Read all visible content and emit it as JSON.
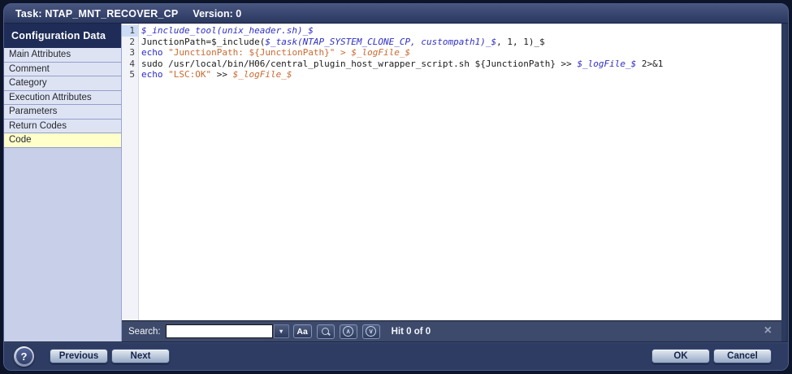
{
  "window": {
    "title": "Task: NTAP_MNT_RECOVER_CP",
    "version_label": "Version: 0"
  },
  "sidebar": {
    "header": "Configuration Data",
    "items": [
      {
        "label": "Main Attributes",
        "selected": false
      },
      {
        "label": "Comment",
        "selected": false
      },
      {
        "label": "Category",
        "selected": false
      },
      {
        "label": "Execution Attributes",
        "selected": false
      },
      {
        "label": "Parameters",
        "selected": false
      },
      {
        "label": "Return Codes",
        "selected": false
      },
      {
        "label": "Code",
        "selected": true
      }
    ]
  },
  "editor": {
    "lines": [
      {
        "number": "1",
        "current": true,
        "tokens": [
          {
            "style": "macro",
            "text": "$_include_tool(unix_header.sh)_$"
          }
        ]
      },
      {
        "number": "2",
        "current": false,
        "tokens": [
          {
            "style": "plain",
            "text": "JunctionPath=$_include("
          },
          {
            "style": "macro",
            "text": "$_task(NTAP_SYSTEM_CLONE_CP, custompath1)_$"
          },
          {
            "style": "plain",
            "text": ", 1, 1)_$"
          }
        ]
      },
      {
        "number": "3",
        "current": false,
        "tokens": [
          {
            "style": "keyword",
            "text": "echo"
          },
          {
            "style": "plain",
            "text": " "
          },
          {
            "style": "string",
            "text": "\"JunctionPath: ${JunctionPath}\""
          },
          {
            "style": "string",
            "text": " > "
          },
          {
            "style": "smacro",
            "text": "$_logFile_$"
          }
        ]
      },
      {
        "number": "4",
        "current": false,
        "tokens": [
          {
            "style": "plain",
            "text": "sudo /usr/local/bin/H06/central_plugin_host_wrapper_script.sh ${JunctionPath} >> "
          },
          {
            "style": "macro",
            "text": "$_logFile_$"
          },
          {
            "style": "plain",
            "text": " 2>&1"
          }
        ]
      },
      {
        "number": "5",
        "current": false,
        "tokens": [
          {
            "style": "keyword",
            "text": "echo"
          },
          {
            "style": "plain",
            "text": " "
          },
          {
            "style": "string",
            "text": "\"LSC:OK\""
          },
          {
            "style": "plain",
            "text": " >> "
          },
          {
            "style": "smacro",
            "text": "$_logFile_$"
          }
        ]
      }
    ]
  },
  "search": {
    "label": "Search:",
    "input_value": "",
    "dropdown_glyph": "▼",
    "match_case_label": "Aa",
    "up_glyph": "∧",
    "down_glyph": "∨",
    "hits": "Hit 0 of 0",
    "close_glyph": "×"
  },
  "footer": {
    "help_glyph": "?",
    "previous_label": "Previous",
    "next_label": "Next",
    "ok_label": "OK",
    "cancel_label": "Cancel"
  },
  "colors": {
    "selected_menu_item": "#ffffca",
    "sidebar_bg": "#c7cfe9",
    "titlebar_bg": "#2b3860",
    "searchbar_bg": "#3e4a6b",
    "code_keyword": "#2929c8",
    "code_macro": "#2f2fc8",
    "code_string": "#c86a31",
    "code_plain": "#1c1c1c",
    "current_line_gutter": "#ccdcf5"
  }
}
